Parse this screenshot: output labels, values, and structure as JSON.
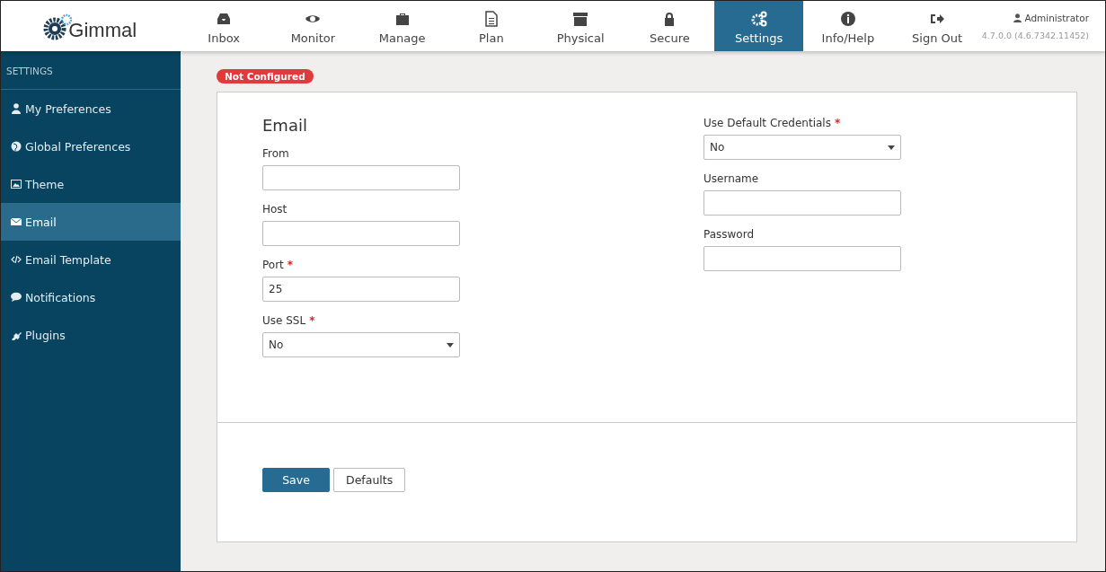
{
  "logo": {
    "text": "Gimmal"
  },
  "nav": [
    {
      "label": "Inbox",
      "selected": false
    },
    {
      "label": "Monitor",
      "selected": false
    },
    {
      "label": "Manage",
      "selected": false
    },
    {
      "label": "Plan",
      "selected": false
    },
    {
      "label": "Physical",
      "selected": false
    },
    {
      "label": "Secure",
      "selected": false
    },
    {
      "label": "Settings",
      "selected": true
    },
    {
      "label": "Info/Help",
      "selected": false
    },
    {
      "label": "Sign Out",
      "selected": false
    }
  ],
  "user": {
    "name": "Administrator",
    "version": "4.7.0.0 (4.6.7342.11452)"
  },
  "sidebar": {
    "heading": "SETTINGS",
    "items": [
      {
        "label": "My Preferences",
        "selected": false
      },
      {
        "label": "Global Preferences",
        "selected": false
      },
      {
        "label": "Theme",
        "selected": false
      },
      {
        "label": "Email",
        "selected": true
      },
      {
        "label": "Email Template",
        "selected": false
      },
      {
        "label": "Notifications",
        "selected": false
      },
      {
        "label": "Plugins",
        "selected": false
      }
    ]
  },
  "status_badge": "Not Configured",
  "form": {
    "title": "Email",
    "left_fields": [
      {
        "label": "From",
        "kind": "text",
        "required": false
      },
      {
        "label": "Host",
        "kind": "text",
        "required": false
      },
      {
        "label": "Port",
        "kind": "text",
        "required": true,
        "value": "25"
      },
      {
        "label": "Use SSL",
        "kind": "select",
        "required": true,
        "value": "No"
      }
    ],
    "right_fields": [
      {
        "label": "Use Default Credentials",
        "kind": "select",
        "required": true,
        "value": "No"
      },
      {
        "label": "Username",
        "kind": "text",
        "required": false
      },
      {
        "label": "Password",
        "kind": "text",
        "required": false
      }
    ],
    "required_mark": "*",
    "buttons": [
      {
        "label": "Save",
        "kind": "primary"
      },
      {
        "label": "Defaults",
        "kind": "secondary"
      }
    ]
  }
}
